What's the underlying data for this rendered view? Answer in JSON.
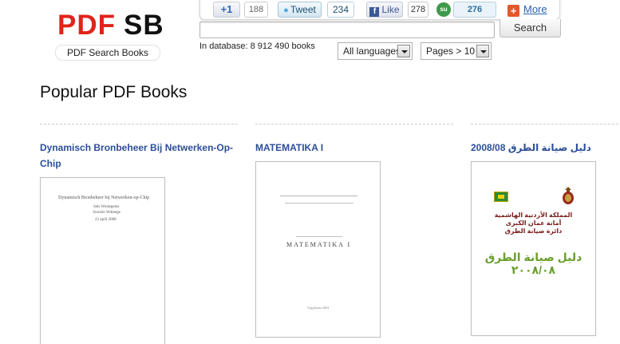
{
  "logo": {
    "pdf": "PDF",
    "sb": "SB",
    "tagline": "PDF Search Books"
  },
  "social": {
    "gplus_label": "+1",
    "gplus_count": "188",
    "tweet_label": "Tweet",
    "tweet_count": "234",
    "like_label": "Like",
    "like_count": "278",
    "stumble_label": "su",
    "stumble_count": "276",
    "more_label": "More"
  },
  "search": {
    "value": "",
    "button": "Search",
    "db_label": "In database:",
    "db_count": "8 912 490 books",
    "language_select": "All languages",
    "pages_select": "Pages > 10"
  },
  "section": {
    "title": "Popular PDF Books"
  },
  "books": [
    {
      "title": "Dynamisch Bronbeheer Bij Netwerken-Op-Chip",
      "cover_lines": [
        "Dynamisch Bronbeheer bij Netwerken-op-Chip",
        "Sels Wolsegems",
        "Kerstin Wittenge",
        "22 april 2008"
      ]
    },
    {
      "title": "MATEMATIKA I",
      "cover_lines": [
        "MATEMATIKA I",
        "Yogyakarta 2004"
      ]
    },
    {
      "title": "دليل صيانة الطرق 2008/08",
      "cover_lines": [
        "المملكة الأردنية الهاشمية",
        "أمانة عمان الكبرى",
        "دائرة صيانة الطرق",
        "دليل صيانة الطرق",
        "٢٠٠٨/٠٨"
      ]
    }
  ]
}
